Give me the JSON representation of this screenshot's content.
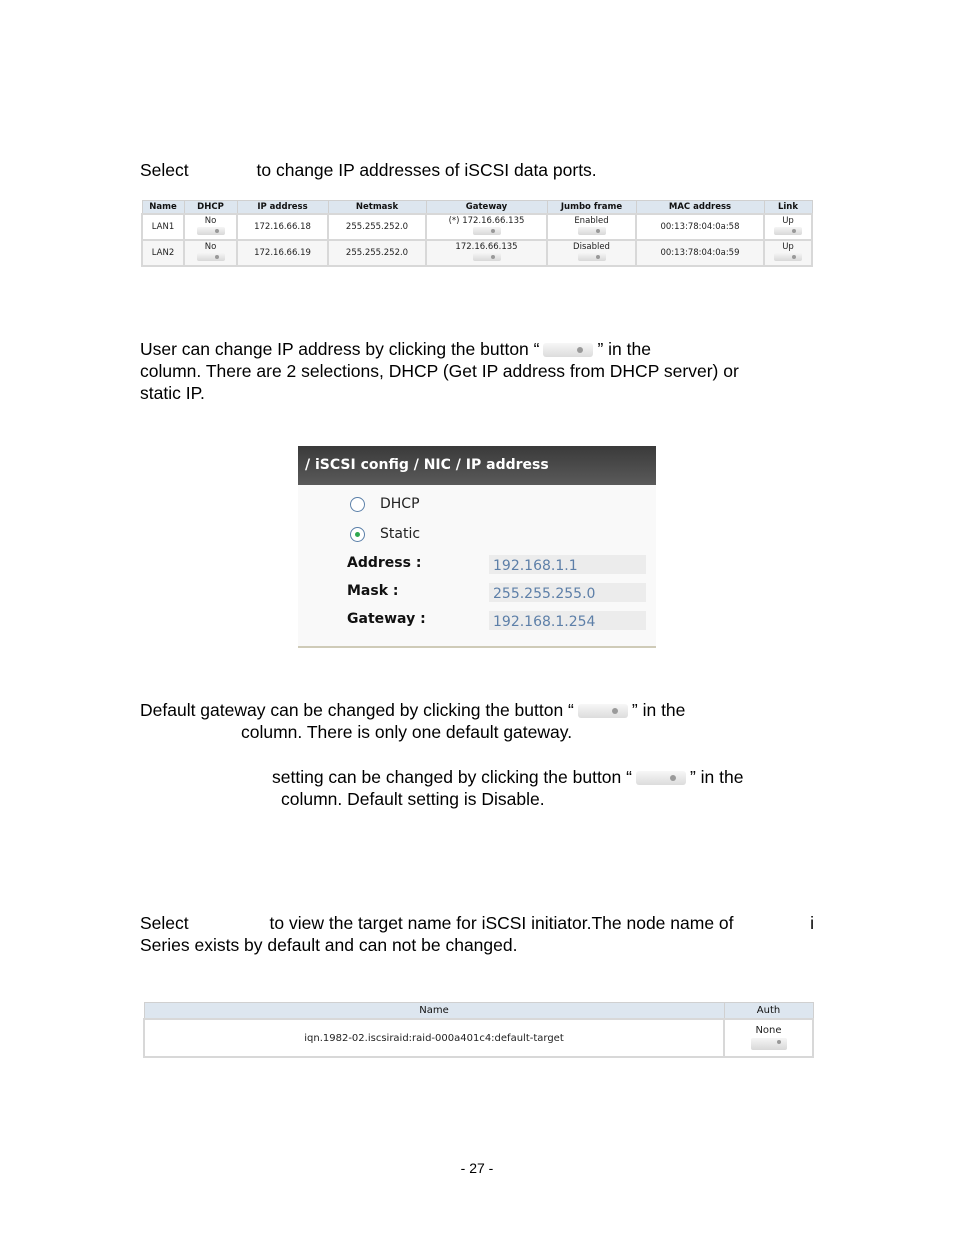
{
  "intro1": {
    "select_word": "Select",
    "rest": "to change IP addresses of iSCSI data ports."
  },
  "nic_table": {
    "headers": [
      "Name",
      "DHCP",
      "IP address",
      "Netmask",
      "Gateway",
      "Jumbo frame",
      "MAC address",
      "Link"
    ],
    "rows": [
      {
        "name": "LAN1",
        "dhcp": "No",
        "ip": "172.16.66.18",
        "netmask": "255.255.252.0",
        "gateway": "(*) 172.16.66.135",
        "jumbo": "Enabled",
        "mac": "00:13:78:04:0a:58",
        "link": "Up"
      },
      {
        "name": "LAN2",
        "dhcp": "No",
        "ip": "172.16.66.19",
        "netmask": "255.255.252.0",
        "gateway": "172.16.66.135",
        "jumbo": "Disabled",
        "mac": "00:13:78:04:0a:59",
        "link": "Up"
      }
    ]
  },
  "para_ip": {
    "l1a": "User can change IP address by clicking the button “",
    "l1b": "” in the",
    "l2": "column. There are 2 selections, DHCP (Get IP address from DHCP server) or",
    "l3": "static IP."
  },
  "ip_panel": {
    "title": "/ iSCSI config / NIC / IP address",
    "options": [
      "DHCP",
      "Static"
    ],
    "selected": "Static",
    "fields": [
      {
        "label": "Address :",
        "value": "192.168.1.1"
      },
      {
        "label": "Mask :",
        "value": "255.255.255.0"
      },
      {
        "label": "Gateway :",
        "value": "192.168.1.254"
      }
    ]
  },
  "para_gw": {
    "l1a": "Default gateway can be changed by clicking the button “",
    "l1b": "” in the",
    "l2": "column. There is only one default gateway."
  },
  "para_jumbo": {
    "l1a": "setting can be changed by clicking the button “",
    "l1b": "” in the",
    "l2": "column. Default setting is Disable."
  },
  "para_node": {
    "l1a": "Select",
    "l1b": "to view the target name for iSCSI initiator.The node name of",
    "l1c": "i",
    "l2": "Series exists by default and can not be changed."
  },
  "target_table": {
    "headers": [
      "Name",
      "Auth"
    ],
    "rows": [
      {
        "name": "iqn.1982-02.iscsiraid:raid-000a401c4:default-target",
        "auth": "None"
      }
    ]
  },
  "page_number": "- 27 -"
}
